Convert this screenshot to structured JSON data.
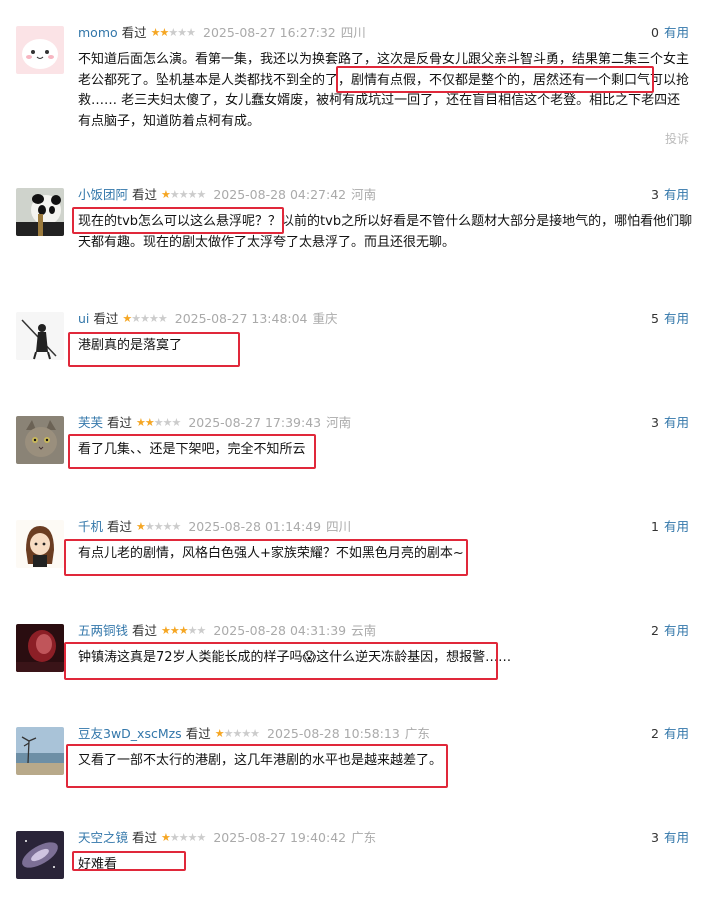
{
  "comments": [
    {
      "user": "momo",
      "watched": "看过",
      "stars": 2,
      "time": "2025-08-27 16:27:32",
      "location": "四川",
      "votes": "0",
      "vote_label": "有用",
      "text": "不知道后面怎么演。看第一集，我还以为换套路了，这次是反骨女儿跟父亲斗智斗勇，结果第二集三个女主老公都死了。坠机基本是人类都找不到全的了，剧情有点假，不仅都是整个的，居然还有一个剩口气可以抢救…… 老三夫妇太傻了，女儿蠢女婿废，被柯有成坑过一回了，还在盲目相信这个老登。相比之下老四还有点脑子，知道防着点柯有成。",
      "report": "投诉",
      "avatar": "pink-blob-avatar"
    },
    {
      "user": "小饭团阿",
      "watched": "看过",
      "stars": 1,
      "time": "2025-08-28 04:27:42",
      "location": "河南",
      "votes": "3",
      "vote_label": "有用",
      "text": "现在的tvb怎么可以这么悬浮呢？？以前的tvb之所以好看是不管什么题材大部分是接地气的，哪怕看他们聊天都有趣。现在的剧太做作了太浮夸了太悬浮了。而且还很无聊。",
      "avatar": "panda-avatar"
    },
    {
      "user": "ui",
      "watched": "看过",
      "stars": 1,
      "time": "2025-08-27 13:48:04",
      "location": "重庆",
      "votes": "5",
      "vote_label": "有用",
      "text": "港剧真的是落寞了",
      "avatar": "swordsman-avatar"
    },
    {
      "user": "芙芙",
      "watched": "看过",
      "stars": 2,
      "time": "2025-08-27 17:39:43",
      "location": "河南",
      "votes": "3",
      "vote_label": "有用",
      "text": "看了几集、、还是下架吧，完全不知所云",
      "avatar": "cat-avatar"
    },
    {
      "user": "千机",
      "watched": "看过",
      "stars": 1,
      "time": "2025-08-28 01:14:49",
      "location": "四川",
      "votes": "1",
      "vote_label": "有用",
      "text": "有点儿老的剧情，风格白色强人+家族荣耀？不如黑色月亮的剧本~",
      "avatar": "cartoon-girl-avatar"
    },
    {
      "user": "五两铜钱",
      "watched": "看过",
      "stars": 3,
      "time": "2025-08-28 04:31:39",
      "location": "云南",
      "votes": "2",
      "vote_label": "有用",
      "text": "钟镇涛这真是72岁人类能长成的样子吗😱这什么逆天冻龄基因，想报警……",
      "avatar": "red-portrait-avatar"
    },
    {
      "user": "豆友3wD_xscMzs",
      "watched": "看过",
      "stars": 1,
      "time": "2025-08-28 10:58:13",
      "location": "广东",
      "votes": "2",
      "vote_label": "有用",
      "text": "又看了一部不太行的港剧，这几年港剧的水平也是越来越差了。",
      "avatar": "seascape-avatar"
    },
    {
      "user": "天空之镜",
      "watched": "看过",
      "stars": 1,
      "time": "2025-08-27 19:40:42",
      "location": "广东",
      "votes": "3",
      "vote_label": "有用",
      "text": "好难看",
      "avatar": "galaxy-avatar"
    }
  ],
  "colors": {
    "username": "#3377aa",
    "star": "#f5a623",
    "highlight": "#e0283a"
  }
}
